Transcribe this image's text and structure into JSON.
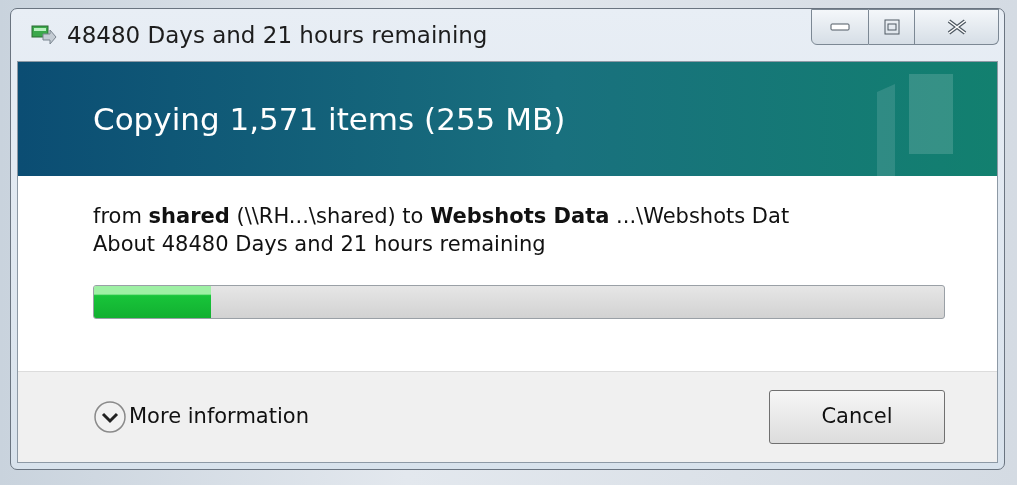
{
  "window": {
    "title": "48480 Days and 21 hours remaining"
  },
  "header": {
    "title": "Copying 1,571 items (255 MB)"
  },
  "details": {
    "from_line": "from **shared** (\\\\RH...\\shared)   to **Webshots Data** ...\\Webshots Dat",
    "remaining": "About 48480 Days and 21 hours remaining"
  },
  "progress": {
    "level": 0.138
  },
  "footer": {
    "more_information": "More information",
    "expanded": false,
    "cancel_button": "Cancel"
  }
}
